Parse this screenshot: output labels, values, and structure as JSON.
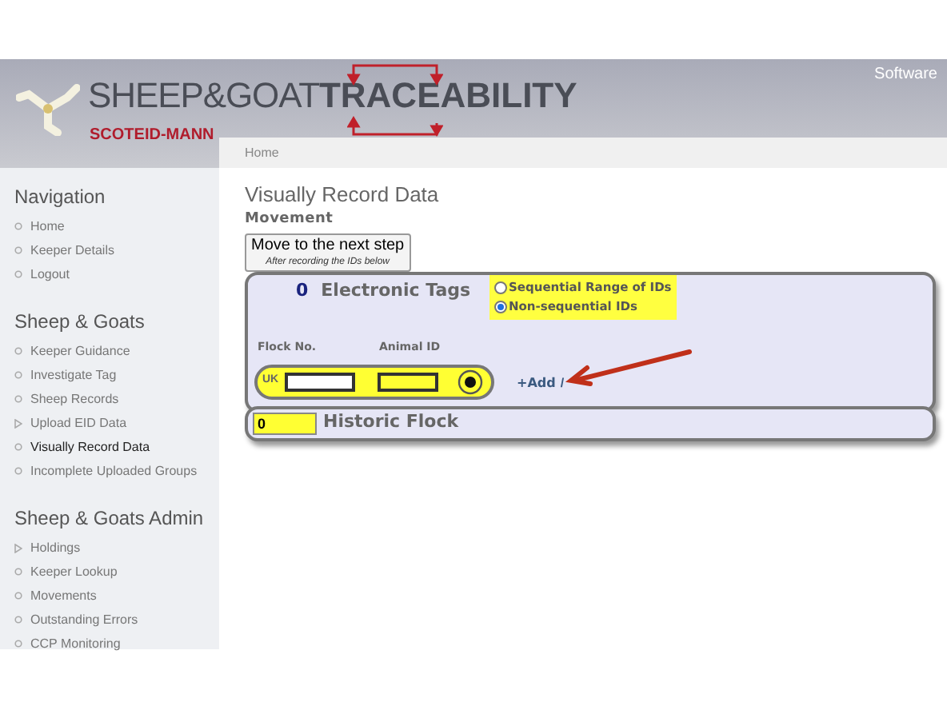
{
  "header": {
    "brand_light": "SHEEP&GOAT",
    "brand_bold": "TRACEABILITY",
    "subtitle": "SCOTEID-MANN",
    "top_link": "Software"
  },
  "breadcrumb": "Home",
  "sidebar": [
    {
      "heading": "Navigation",
      "items": [
        {
          "label": "Home",
          "kind": "link",
          "selected": false
        },
        {
          "label": "Keeper Details",
          "kind": "link",
          "selected": false
        },
        {
          "label": "Logout",
          "kind": "link",
          "selected": false
        }
      ]
    },
    {
      "heading": "Sheep & Goats",
      "items": [
        {
          "label": "Keeper Guidance",
          "kind": "link",
          "selected": false
        },
        {
          "label": "Investigate Tag",
          "kind": "link",
          "selected": false
        },
        {
          "label": "Sheep Records",
          "kind": "link",
          "selected": false
        },
        {
          "label": "Upload EID Data",
          "kind": "expandable",
          "selected": false
        },
        {
          "label": "Visually Record Data",
          "kind": "link",
          "selected": true
        },
        {
          "label": "Incomplete Uploaded Groups",
          "kind": "link",
          "selected": false
        }
      ]
    },
    {
      "heading": "Sheep & Goats Admin",
      "items": [
        {
          "label": "Holdings",
          "kind": "expandable",
          "selected": false
        },
        {
          "label": "Keeper Lookup",
          "kind": "link",
          "selected": false
        },
        {
          "label": "Movements",
          "kind": "link",
          "selected": false
        },
        {
          "label": "Outstanding Errors",
          "kind": "link",
          "selected": false
        },
        {
          "label": "CCP Monitoring",
          "kind": "link",
          "selected": false
        }
      ]
    }
  ],
  "page": {
    "title": "Visually Record Data",
    "section": "Movement",
    "next_button": {
      "label": "Move to the next step",
      "note": "After recording the IDs below"
    },
    "tags_panel": {
      "count": "0",
      "title": "Electronic Tags",
      "options": [
        {
          "label": "Sequential Range of IDs",
          "selected": false
        },
        {
          "label": "Non-sequential IDs",
          "selected": true
        }
      ],
      "flock_label": "Flock No.",
      "animal_label": "Animal ID",
      "country": "UK",
      "add_link": "+Add",
      "separator": "/"
    },
    "historic": {
      "value": "0",
      "title": "Historic Flock"
    }
  }
}
